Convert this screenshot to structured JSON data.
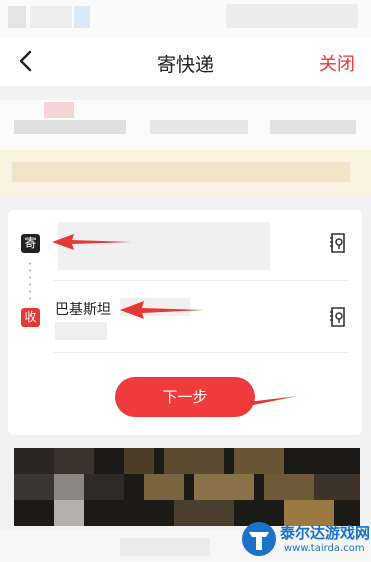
{
  "header": {
    "title": "寄快递",
    "close_label": "关闭"
  },
  "form": {
    "sender": {
      "tag": "寄",
      "icon": "address-book-icon"
    },
    "recipient": {
      "tag": "收",
      "name": "巴基斯坦",
      "icon": "address-book-icon"
    },
    "next_label": "下一步"
  },
  "watermark": {
    "title": "泰尔达游戏网",
    "url": "www.tairda.com"
  },
  "colors": {
    "accent": "#e53935",
    "button": "#ef3b3b",
    "sender_tag": "#222222",
    "notice_bg": "#fbf3e2",
    "watermark": "#1a73c8"
  }
}
